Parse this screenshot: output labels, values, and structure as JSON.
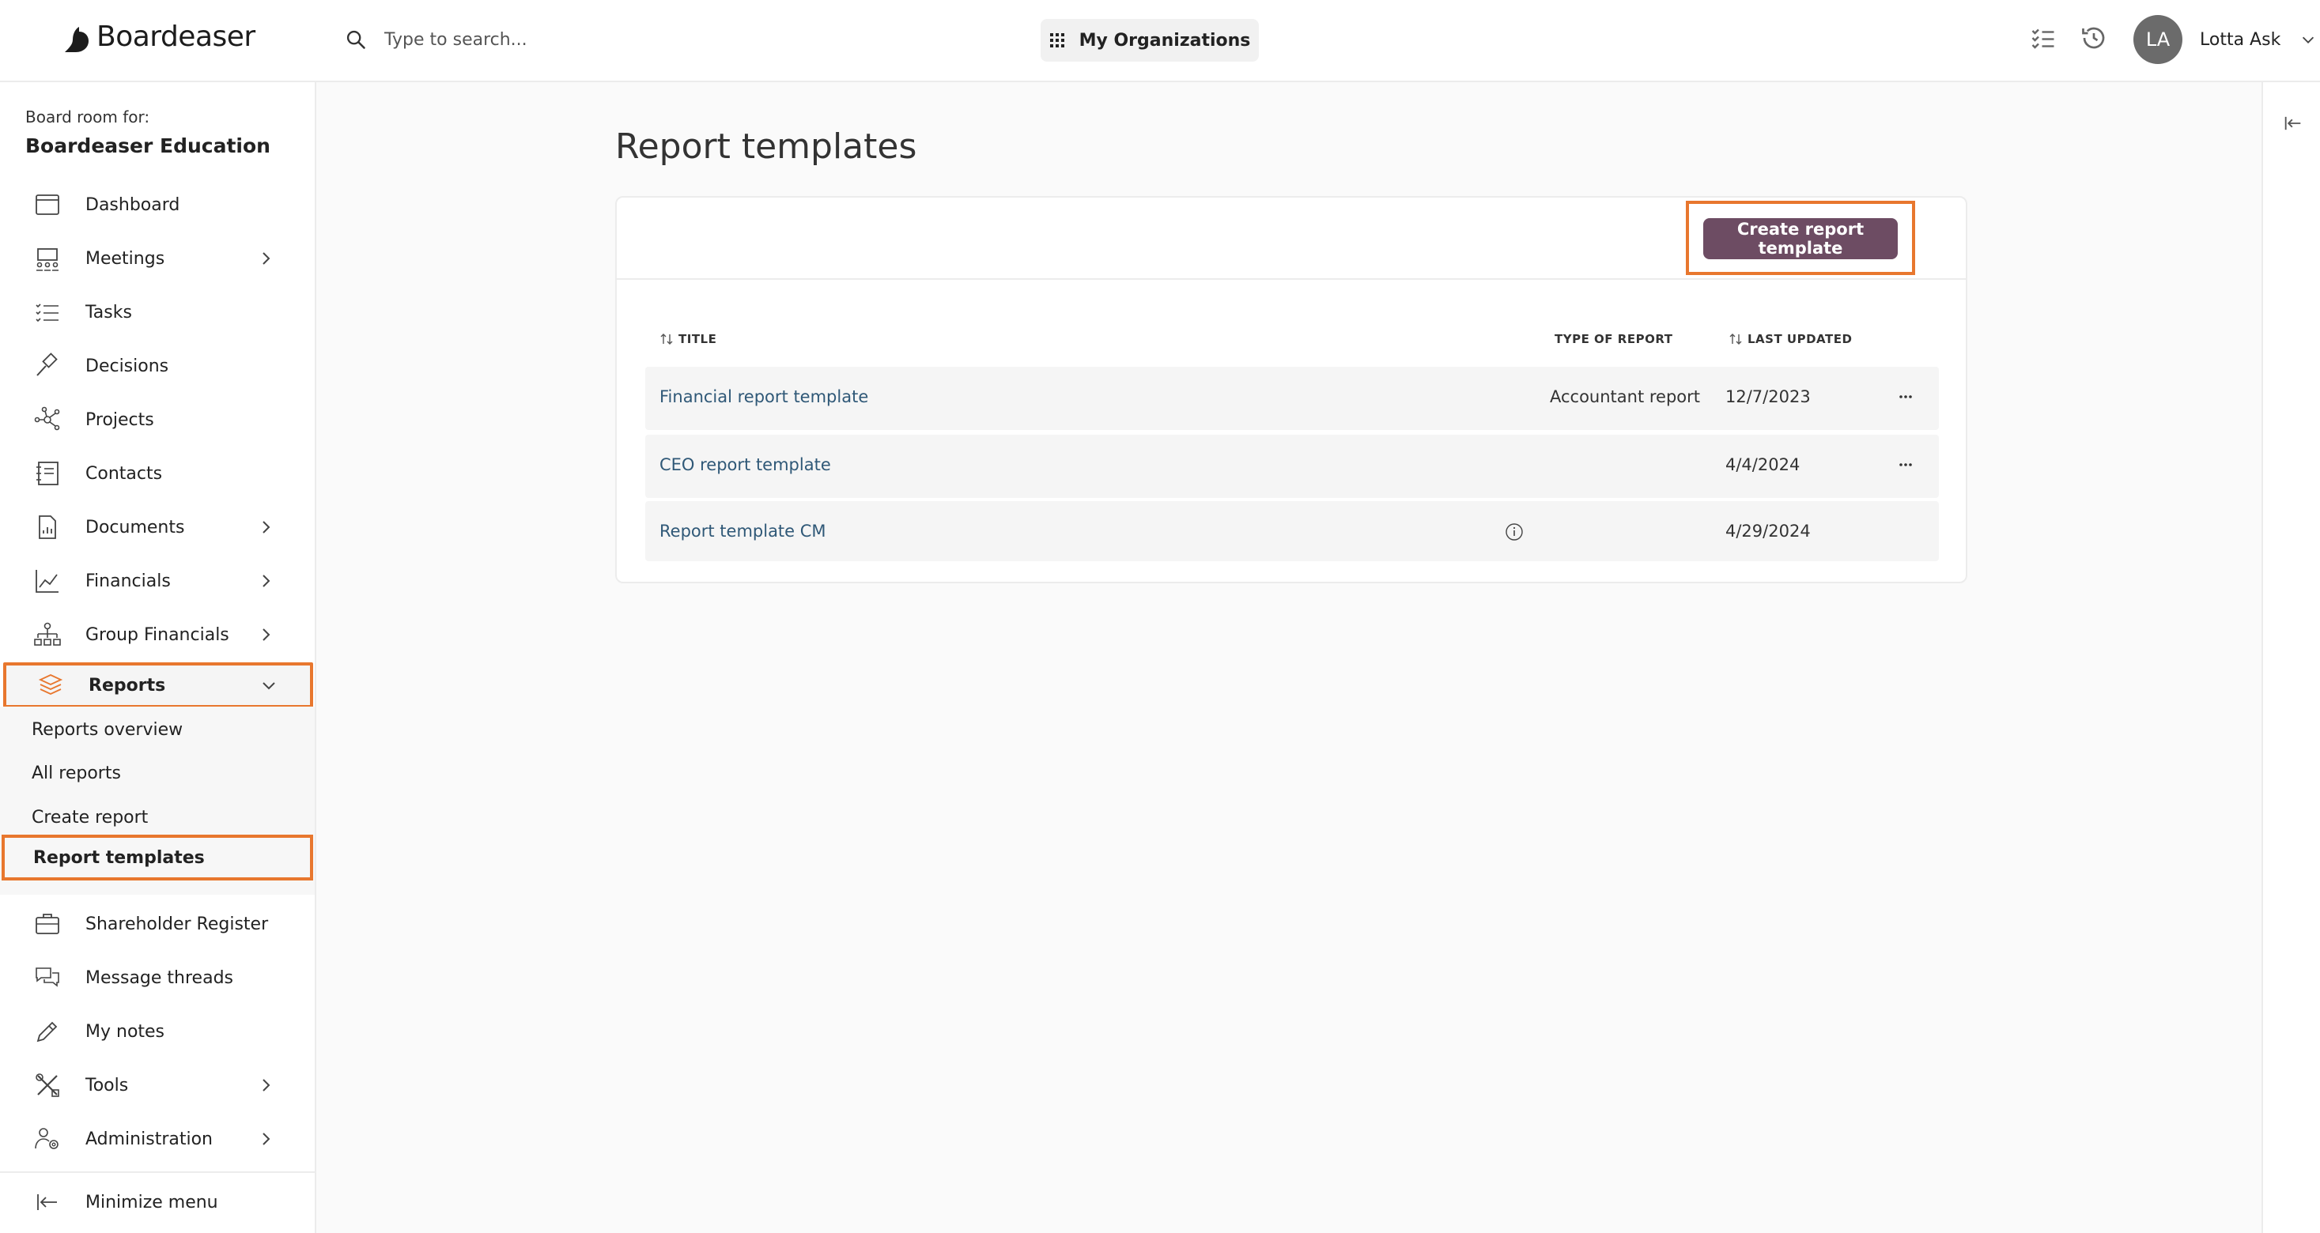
{
  "brand": {
    "name": "Boardeaser"
  },
  "search": {
    "placeholder": "Type to search..."
  },
  "orgs_button": {
    "label": "My Organizations"
  },
  "user": {
    "initials": "LA",
    "name": "Lotta Ask"
  },
  "sidebar": {
    "board_for": "Board room for:",
    "org_name": "Boardeaser Education",
    "items": [
      {
        "label": "Dashboard",
        "icon": "calendar-icon",
        "expandable": false
      },
      {
        "label": "Meetings",
        "icon": "meeting-icon",
        "expandable": true
      },
      {
        "label": "Tasks",
        "icon": "tasks-icon",
        "expandable": false
      },
      {
        "label": "Decisions",
        "icon": "gavel-icon",
        "expandable": false
      },
      {
        "label": "Projects",
        "icon": "network-icon",
        "expandable": false
      },
      {
        "label": "Contacts",
        "icon": "contacts-icon",
        "expandable": false
      },
      {
        "label": "Documents",
        "icon": "document-icon",
        "expandable": true
      },
      {
        "label": "Financials",
        "icon": "chart-line-icon",
        "expandable": true
      },
      {
        "label": "Group Financials",
        "icon": "org-chart-icon",
        "expandable": true
      },
      {
        "label": "Reports",
        "icon": "layers-icon",
        "expandable": true,
        "expanded": true
      },
      {
        "label": "Shareholder Register",
        "icon": "briefcase-icon",
        "expandable": false
      },
      {
        "label": "Message threads",
        "icon": "chat-icon",
        "expandable": false
      },
      {
        "label": "My notes",
        "icon": "pencil-icon",
        "expandable": false
      },
      {
        "label": "Tools",
        "icon": "tools-icon",
        "expandable": true
      },
      {
        "label": "Administration",
        "icon": "users-gear-icon",
        "expandable": true
      }
    ],
    "reports_sub": [
      {
        "label": "Reports overview"
      },
      {
        "label": "All reports"
      },
      {
        "label": "Create report"
      },
      {
        "label": "Report templates",
        "active": true
      }
    ],
    "minimize_label": "Minimize menu"
  },
  "main": {
    "title": "Report templates",
    "create_button": "Create report template",
    "columns": {
      "title": "TITLE",
      "type": "TYPE OF REPORT",
      "updated": "LAST UPDATED"
    },
    "rows": [
      {
        "title": "Financial report template",
        "type": "Accountant report",
        "updated": "12/7/2023",
        "menu": true
      },
      {
        "title": "CEO report template",
        "type": "",
        "updated": "4/4/2024",
        "menu": true
      },
      {
        "title": "Report template CM",
        "type": "",
        "updated": "4/29/2024",
        "info": true
      }
    ]
  },
  "colors": {
    "accent": "#e8772e",
    "primary_button": "#6d4c63",
    "link": "#2f5877"
  }
}
